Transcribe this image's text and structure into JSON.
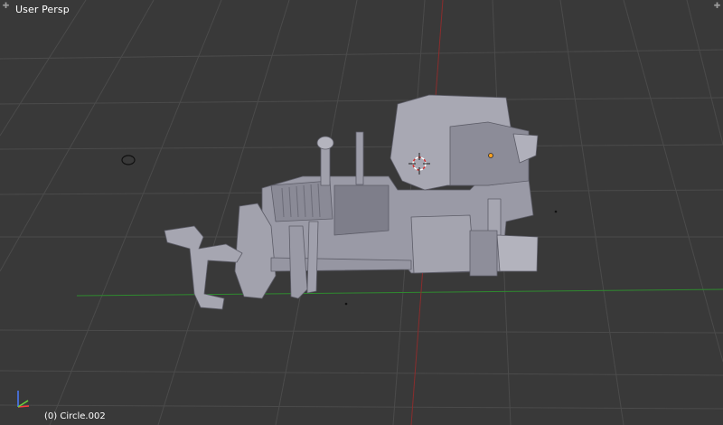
{
  "viewport": {
    "view_label": "User Persp",
    "object_label": "(0) Circle.002"
  },
  "axis_gizmo": {
    "x_color": "#ff3d3d",
    "y_color": "#6cd43c",
    "z_color": "#4a7cff"
  },
  "colors": {
    "background": "#393939",
    "grid": "#4c4c4c",
    "x_axis_line": "#2e8b2e",
    "y_axis_line": "#8a2a2a",
    "mesh_light": "#a9a9b4",
    "mesh_mid": "#8f8f9c",
    "mesh_dark": "#6e6e7a",
    "origin_dot": "#ffa020"
  },
  "icons": {
    "corner_left": "plus-corner-icon",
    "corner_right": "plus-corner-icon",
    "cursor": "3d-cursor-icon",
    "lamp": "lamp-icon"
  }
}
